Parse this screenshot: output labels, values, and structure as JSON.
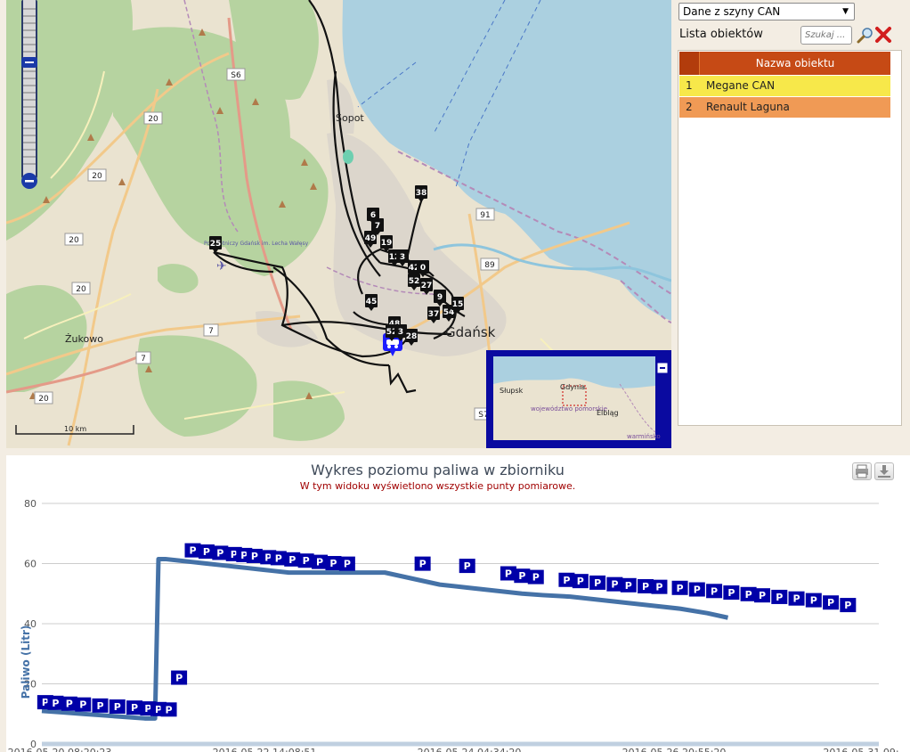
{
  "map": {
    "scale_label": "10 km",
    "place_labels": {
      "sopot": "Sopot",
      "gdansk": "Gdańsk",
      "zukowo": "Żukowo",
      "airport": "Port Lotniczy Gdańsk im. Lecha Wałęsy"
    },
    "road_numbers": [
      "S6",
      "20",
      "20",
      "20",
      "20",
      "20",
      "7",
      "7",
      "91",
      "89",
      "S7"
    ],
    "markers": [
      "38",
      "6",
      "7",
      "49",
      "19",
      "12",
      "3",
      "42",
      "0",
      "52",
      "27",
      "45",
      "9",
      "37",
      "54",
      "15",
      "48",
      "52",
      "3",
      "28",
      "25"
    ],
    "overview_labels": {
      "slupsk": "Słupsk",
      "gdynia": "Gdynia",
      "region": "województwo pomorskie",
      "elblag": "Elbląg",
      "warminsko": "warmińsko"
    }
  },
  "panel": {
    "source_select": "Dane z szyny CAN",
    "list_title": "Lista obiektów",
    "search_placeholder": "Szukaj ...",
    "table_header": "Nazwa obiektu",
    "objects": [
      {
        "num": "1",
        "name": "Megane CAN",
        "color": "#f7e84a"
      },
      {
        "num": "2",
        "name": "Renault Laguna",
        "color": "#f09a55"
      }
    ]
  },
  "chart_data": {
    "type": "line",
    "title": "Wykres poziomu paliwa w zbiorniku",
    "subtitle": "W tym widoku wyświetlono wszystkie punty pomiarowe.",
    "ylabel": "Paliwo (Litr)",
    "ylim": [
      0,
      80
    ],
    "yticks": [
      0,
      20,
      40,
      60,
      80
    ],
    "xtick_labels": [
      "2016-05-20 08:20:23",
      "2016-05-22 14:08:51",
      "2016-05-24 04:34:20",
      "2016-05-26 20:55:20",
      "2016-05-31 09:"
    ],
    "marker_label": "P",
    "series": [
      {
        "color": "#4572a7",
        "x": [
          0,
          3,
          6,
          9,
          12,
          15,
          16.5,
          17,
          18,
          20,
          22,
          24,
          26,
          28,
          30,
          32,
          34,
          36,
          38,
          40,
          42,
          44,
          46,
          50,
          54,
          58,
          62,
          66,
          70,
          73,
          77,
          81,
          85,
          89,
          93,
          97,
          100
        ],
        "y": [
          11,
          10.5,
          10,
          9.5,
          9,
          8.5,
          8.5,
          61.5,
          61.5,
          61,
          60.5,
          60,
          59.5,
          59,
          58.5,
          58,
          57.5,
          57,
          57,
          57,
          57,
          57,
          57,
          57,
          55,
          53,
          52,
          51,
          50,
          49.5,
          49,
          48,
          47,
          46,
          45,
          43.5,
          42
        ]
      }
    ],
    "markers_x": [
      0.5,
      2,
      4,
      6,
      8.5,
      11,
      13.5,
      15.5,
      17,
      18.5,
      20,
      22,
      24,
      26,
      28,
      29.5,
      31,
      33,
      34.5,
      36.5,
      38.5,
      40.5,
      42.5,
      44.5,
      55.5,
      62,
      68,
      70,
      72,
      76.5,
      78.5,
      81,
      83.5,
      85.5,
      88,
      90,
      93,
      95.5,
      98,
      100.5,
      103,
      105,
      107.5,
      110,
      112.5,
      115,
      117.5
    ]
  },
  "colors": {
    "accent": "#c64a15",
    "marker": "#0000a8",
    "series": "#4572a7"
  }
}
